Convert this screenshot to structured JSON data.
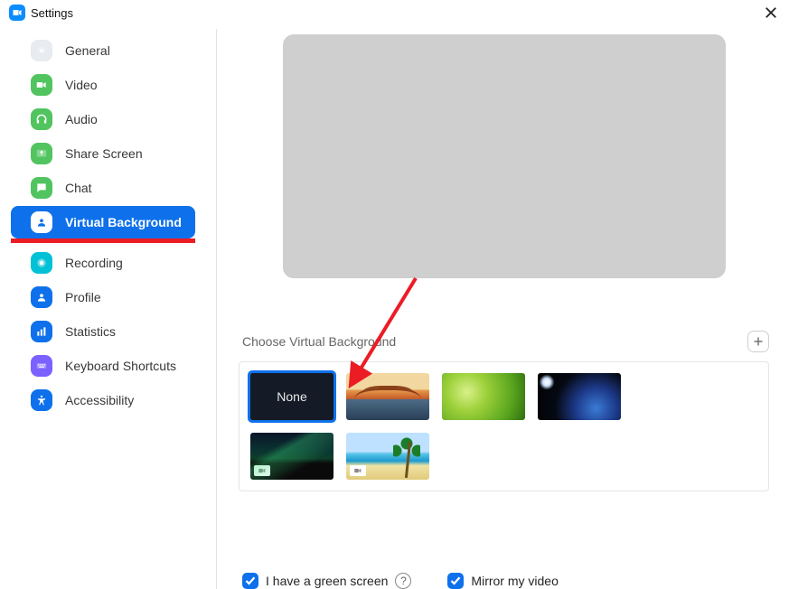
{
  "window": {
    "title": "Settings"
  },
  "sidebar": {
    "items": [
      {
        "label": "General"
      },
      {
        "label": "Video"
      },
      {
        "label": "Audio"
      },
      {
        "label": "Share Screen"
      },
      {
        "label": "Chat"
      },
      {
        "label": "Virtual Background"
      },
      {
        "label": "Recording"
      },
      {
        "label": "Profile"
      },
      {
        "label": "Statistics"
      },
      {
        "label": "Keyboard Shortcuts"
      },
      {
        "label": "Accessibility"
      }
    ]
  },
  "content": {
    "section_label": "Choose Virtual Background",
    "thumbs": {
      "none_label": "None"
    },
    "options": {
      "green_screen": "I have a green screen",
      "mirror": "Mirror my video"
    }
  }
}
